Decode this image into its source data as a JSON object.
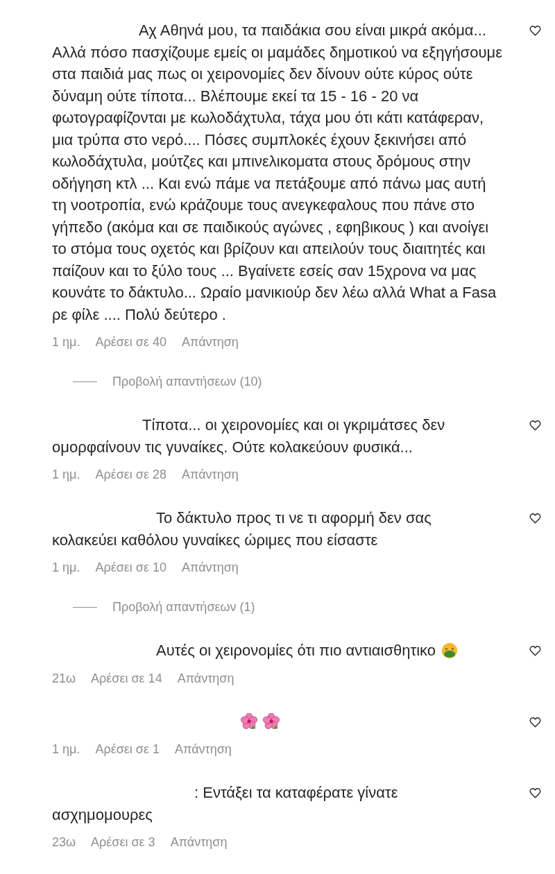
{
  "comments_thread": [
    {
      "kind": "comment_text",
      "text": "Αχ Αθηνά μου, τα παιδάκια σου είναι μικρά ακόμα... Αλλά πόσο πασχίζουμε εμείς οι μαμάδες δημοτικού να εξηγήσουμε στα παιδιά μας πως οι χειρονομίες δεν δίνουν ούτε κύρος ούτε δύναμη ούτε τίποτα... Βλέπουμε εκεί τα 15 - 16 - 20 να φωτογραφίζονται με κωλοδάχτυλα, τάχα μου ότι κάτι κατάφεραν, μια τρύπα στο νερό.... Πόσες συμπλοκές έχουν ξεκινήσει από κωλοδάχτυλα, μούτζες και μπινελικοματα στους δρόμους στην οδήγηση κτλ ... Και ενώ πάμε να πετάξουμε από πάνω μας αυτή τη νοοτροπία, ενώ κράζουμε τους ανεγκεφαλους που πάνε στο γήπεδο (ακόμα και σε παιδικούς αγώνες , εφηβικους ) και ανοίγει το στόμα τους οχετός και βρίζουν και απειλούν τους διαιτητές και παίζουν και το ξύλο τους ... Βγαίνετε εσείς σαν 15χρονα να μας κουνάτε το δάκτυλο... Ωραίο μανικιούρ δεν λέω αλλά What a Fasa ρε φίλε .... Πολύ δεύτερο .",
      "time": "1 ημ.",
      "likes": "Αρέσει σε 40",
      "reply": "Απάντηση"
    },
    {
      "kind": "view_replies",
      "label": "Προβολή απαντήσεων (10)"
    },
    {
      "kind": "comment_text",
      "text": "Τίποτα... οι χειρονομίες και οι γκριμάτσες δεν ομορφαίνουν τις γυναίκες. Ούτε κολακεύουν φυσικά...",
      "time": "1 ημ.",
      "likes": "Αρέσει σε 28",
      "reply": "Απάντηση"
    },
    {
      "kind": "comment_text",
      "text": "Το δάκτυλο προς τι νε τι αφορμή δεν σας κολακεύει καθόλου γυναίκες ώριμες που είσαστε",
      "time": "1 ημ.",
      "likes": "Αρέσει σε 10",
      "reply": "Απάντηση"
    },
    {
      "kind": "view_replies",
      "label": "Προβολή απαντήσεων (1)"
    },
    {
      "kind": "comment_text_emoji",
      "text": "Αυτές οι χειρονομίες ότι πιο αντιαισθητικο",
      "time": "21ω",
      "likes": "Αρέσει σε 14",
      "reply": "Απάντηση"
    },
    {
      "kind": "comment_emoji",
      "time": "1 ημ.",
      "likes": "Αρέσει σε 1",
      "reply": "Απάντηση"
    },
    {
      "kind": "comment_text",
      "text": ": Εντάξει τα καταφέρατε γίνατε ασχημομουρες",
      "time": "23ω",
      "likes": "Αρέσει σε 3",
      "reply": "Απάντηση"
    }
  ]
}
